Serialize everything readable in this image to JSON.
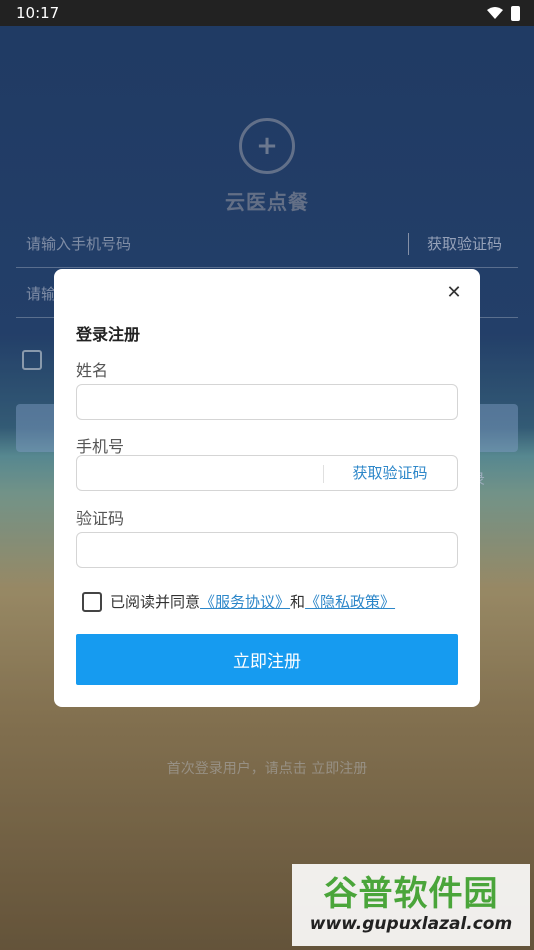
{
  "status_bar": {
    "time": "10:17",
    "icons": [
      "wifi-icon",
      "battery-icon"
    ]
  },
  "login_page": {
    "logo_icon": "medical-cross-icon",
    "app_name": "云医点餐",
    "phone_placeholder": "请输入手机号码",
    "code_placeholder": "请输",
    "get_code_label": "获取验证码",
    "password_login_label": "录",
    "register_hint": "首次登录用户，请点击 立即注册"
  },
  "dialog": {
    "title": "登录注册",
    "close_icon": "close-icon",
    "name_label": "姓名",
    "name_value": "",
    "phone_label": "手机号",
    "phone_value": "",
    "get_code_label": "获取验证码",
    "code_label": "验证码",
    "code_value": "",
    "agree_text": "已阅读并同意",
    "service_link": "《服务协议》",
    "and_text": "和",
    "privacy_link": "《隐私政策》",
    "submit_label": "立即注册",
    "accent_color": "#169bf0",
    "link_color": "#2d87c9"
  },
  "watermark": {
    "title": "谷普软件园",
    "url": "www.gupuxlazal.com"
  }
}
